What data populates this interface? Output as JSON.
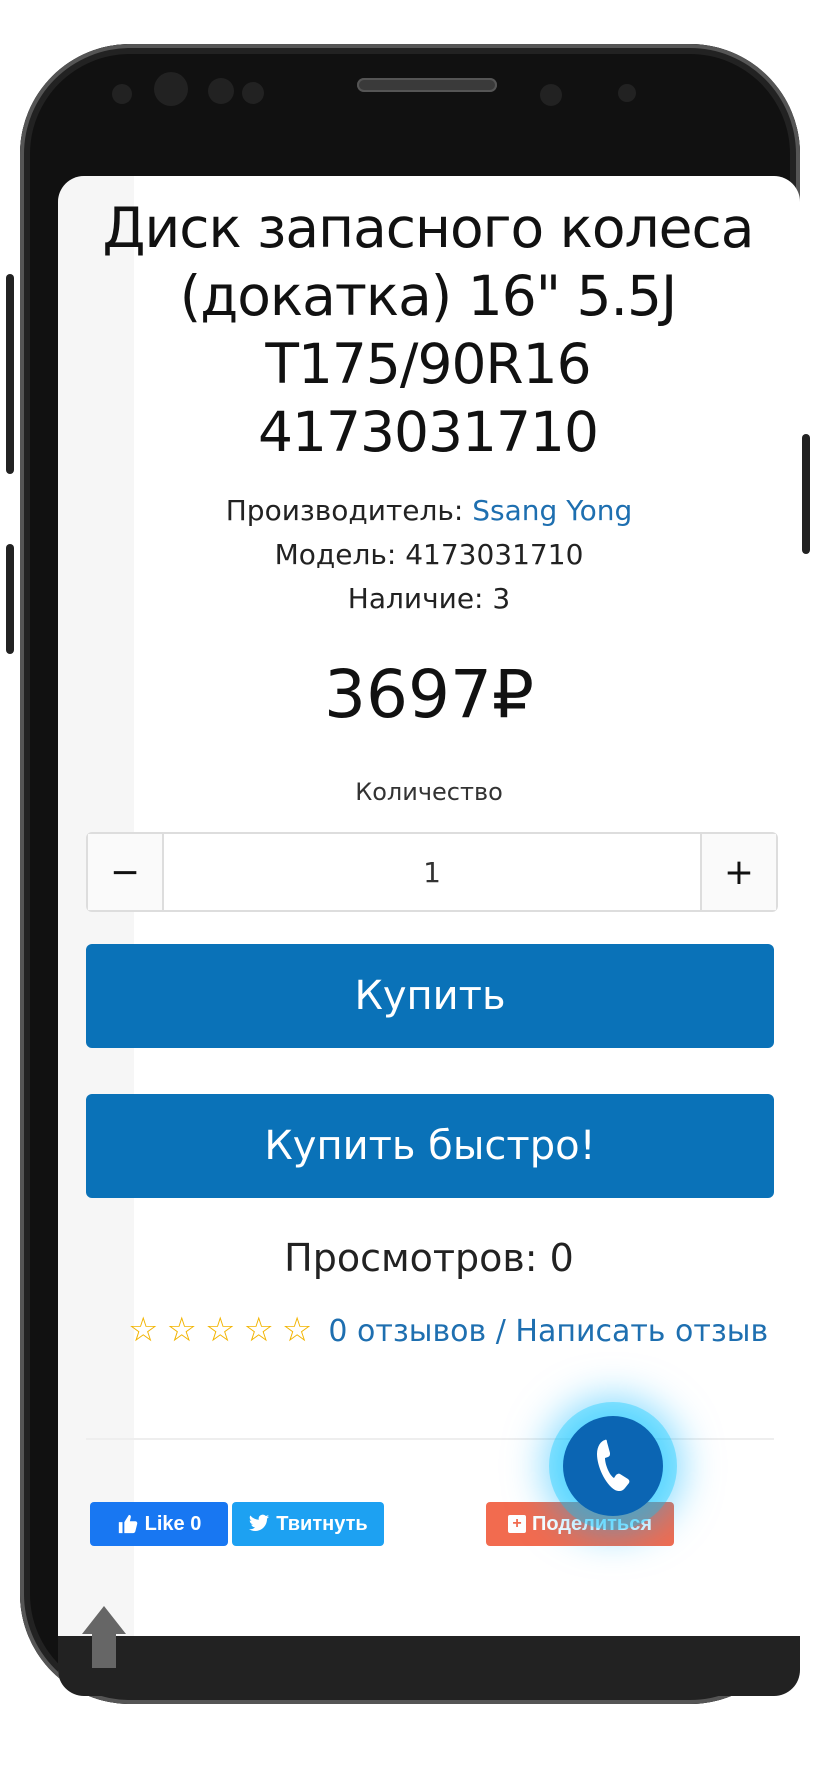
{
  "product": {
    "title": "Диск запасного колеса (докатка) 16\" 5.5J T175/90R16 4173031710",
    "manufacturer_label": "Производитель:",
    "manufacturer_value": "Ssang Yong",
    "model_label": "Модель:",
    "model_value": "4173031710",
    "availability_label": "Наличие:",
    "availability_value": "3",
    "price": "3697₽"
  },
  "quantity": {
    "label": "Количество",
    "minus": "−",
    "value": "1",
    "plus": "+"
  },
  "buttons": {
    "buy": "Купить",
    "buy_fast": "Купить быстро!"
  },
  "stats": {
    "views": "Просмотров: 0",
    "stars": "☆☆☆☆☆",
    "reviews_link": "0 отзывов / Написать отзыв"
  },
  "social": {
    "fb_like": "Like 0",
    "tweet": "Твитнуть",
    "share": "Поделиться"
  },
  "colors": {
    "accent": "#0a72b8",
    "link": "#1e6fb0",
    "star": "#f2b400"
  },
  "icons": [
    "phone-call-icon",
    "thumbs-up-icon",
    "twitter-bird-icon",
    "plus-share-icon",
    "arrow-up-icon"
  ]
}
